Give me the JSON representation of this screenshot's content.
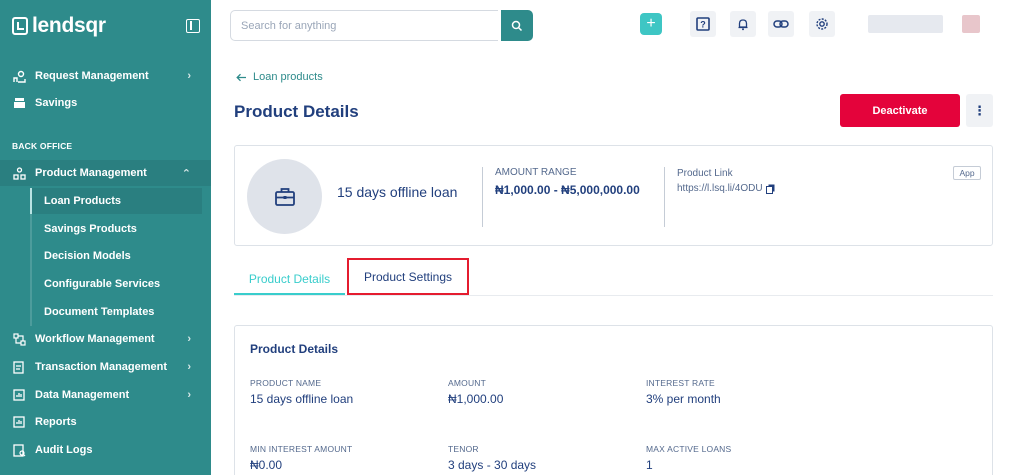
{
  "brand": {
    "name": "lendsqr"
  },
  "sidebar": {
    "top_items": [
      {
        "label": "Request Management",
        "icon": "request-icon",
        "chevron": "›"
      },
      {
        "label": "Savings",
        "icon": "savings-icon"
      }
    ],
    "section_label": "BACK OFFICE",
    "product_management": {
      "label": "Product Management",
      "icon": "product-icon",
      "chevron": "⌃"
    },
    "sub_items": [
      {
        "label": "Loan Products",
        "active": true
      },
      {
        "label": "Savings Products"
      },
      {
        "label": "Decision Models"
      },
      {
        "label": "Configurable Services"
      },
      {
        "label": "Document Templates"
      }
    ],
    "bottom_items": [
      {
        "label": "Workflow Management",
        "icon": "workflow-icon",
        "chevron": "›"
      },
      {
        "label": "Transaction Management",
        "icon": "transaction-icon",
        "chevron": "›"
      },
      {
        "label": "Data Management",
        "icon": "data-icon",
        "chevron": "›"
      },
      {
        "label": "Reports",
        "icon": "reports-icon"
      },
      {
        "label": "Audit Logs",
        "icon": "audit-icon"
      }
    ]
  },
  "topbar": {
    "search_placeholder": "Search for anything",
    "icons": [
      "plus-icon",
      "help-icon",
      "bell-icon",
      "link-icon",
      "settings-icon"
    ]
  },
  "main": {
    "back_link": "Loan products",
    "title": "Product Details",
    "deactivate_label": "Deactivate",
    "more_label": "⋮",
    "summary": {
      "product_name": "15 days offline loan",
      "amount_range_label": "AMOUNT RANGE",
      "amount_range_value": "₦1,000.00 - ₦5,000,000.00",
      "product_link_label": "Product Link",
      "product_link_value": "https://l.lsq.li/4ODU",
      "app_badge": "App"
    },
    "tabs": [
      {
        "label": "Product Details",
        "active": true
      },
      {
        "label": "Product Settings",
        "highlighted": true
      }
    ],
    "details": {
      "title": "Product Details",
      "fields": [
        {
          "label": "PRODUCT NAME",
          "value": "15 days offline loan"
        },
        {
          "label": "AMOUNT",
          "value": "₦1,000.00"
        },
        {
          "label": "INTEREST RATE",
          "value": "3% per month"
        },
        {
          "label": "MIN INTEREST AMOUNT",
          "value": "₦0.00"
        },
        {
          "label": "TENOR",
          "value": "3 days - 30 days"
        },
        {
          "label": "MAX ACTIVE LOANS",
          "value": "1"
        }
      ]
    }
  },
  "colors": {
    "sidebar": "#2e8b8b",
    "accent": "#39cdcc",
    "danger": "#e4033b",
    "text": "#213f7d"
  }
}
